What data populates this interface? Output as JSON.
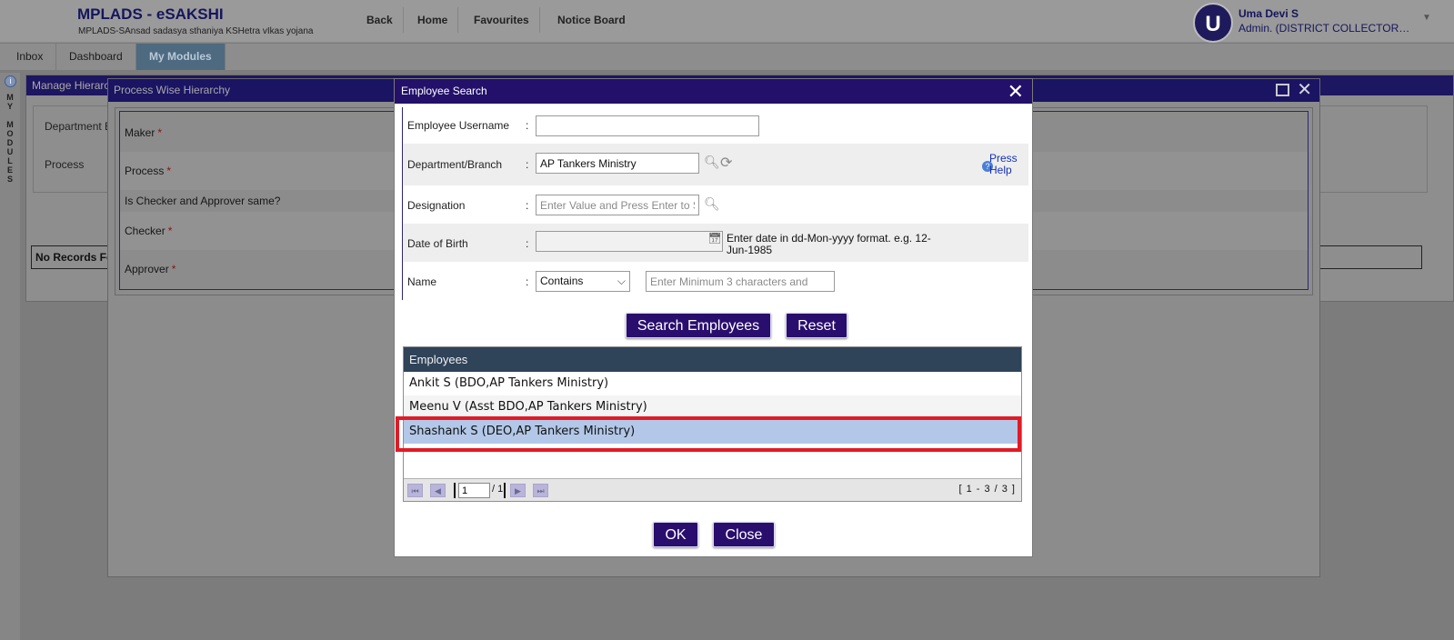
{
  "header": {
    "app_title": "MPLADS - eSAKSHI",
    "app_subtitle": "MPLADS-SAnsad sadasya sthaniya KSHetra vIkas yojana",
    "nav": [
      "Back",
      "Home",
      "Favourites",
      "Notice Board"
    ],
    "user_initial": "U",
    "user_name": "Uma Devi S",
    "user_role": "Admin. (DISTRICT COLLECTOR…"
  },
  "tabs": [
    "Inbox",
    "Dashboard",
    "My Modules"
  ],
  "left_rail": {
    "text": "M\nY\n\nM\nO\nD\nU\nL\nE\nS"
  },
  "background_page": {
    "title": "Manage Hierarc",
    "fields": [
      "Department B",
      "Process"
    ],
    "no_records": "No Records Fo"
  },
  "process_dialog": {
    "title": "Process Wise Hierarchy",
    "fields": [
      {
        "label": "Maker",
        "required": "*"
      },
      {
        "label": "Process",
        "required": "*"
      },
      {
        "label": "Is Checker and Approver same?",
        "required": ""
      },
      {
        "label": "Checker",
        "required": "*"
      },
      {
        "label": "Approver",
        "required": "*"
      }
    ]
  },
  "employee_search": {
    "title": "Employee Search",
    "colon": ":",
    "fields": {
      "username_label": "Employee Username",
      "username_value": "",
      "department_label": "Department/Branch",
      "department_value": "AP Tankers Ministry",
      "designation_label": "Designation",
      "designation_placeholder": "Enter Value and Press Enter to S",
      "dob_label": "Date of Birth",
      "dob_note": "Enter date in dd-Mon-yyyy format. e.g. 12-Jun-1985",
      "name_label": "Name",
      "name_match": "Contains",
      "name_placeholder": "Enter Minimum 3 characters and"
    },
    "help_text": "Press Help",
    "search_button": "Search Employees",
    "reset_button": "Reset",
    "grid": {
      "header": "Employees",
      "rows": [
        "Ankit S (BDO,AP Tankers Ministry)",
        "Meenu V (Asst BDO,AP Tankers Ministry)",
        "Shashank S (DEO,AP Tankers Ministry)"
      ],
      "selected_index": 2
    },
    "pager": {
      "page": "1",
      "of": "/ 1",
      "range": "[ 1 - 3 / 3 ]"
    },
    "ok_button": "OK",
    "close_button": "Close"
  },
  "colors": {
    "dialog_titlebar": "#23106a",
    "button_primary": "#2a0e6e",
    "grid_header": "#2f4359",
    "selected_row": "#b3c8e8",
    "highlight_border": "#e21a25"
  }
}
